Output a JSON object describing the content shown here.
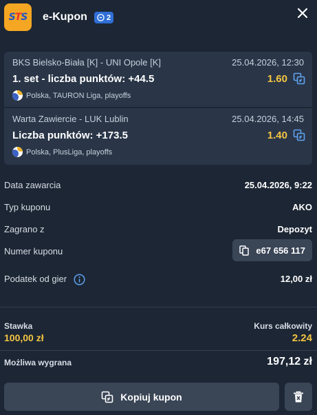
{
  "header": {
    "logo_text_left": "S",
    "logo_text_mid": "T",
    "logo_text_right": "S",
    "title": "e-Kupon",
    "bet_count": "2",
    "close_icon": "close-icon"
  },
  "bets": [
    {
      "match": "BKS Bielsko-Biała [K] - UNI Opole [K]",
      "date": "25.04.2026, 12:30",
      "market": "1. set - liczba punktów: +44.5",
      "odds": "1.60",
      "league": "Polska, TAURON Liga, playoffs",
      "sport_icon": "volleyball-icon"
    },
    {
      "match": "Warta Zawiercie - LUK Lublin",
      "date": "25.04.2026, 14:45",
      "market": "Liczba punktów: +173.5",
      "odds": "1.40",
      "league": "Polska, PlusLiga, playoffs",
      "sport_icon": "volleyball-icon"
    }
  ],
  "details": {
    "date_label": "Data zawarcia",
    "date_value": "25.04.2026, 9:22",
    "type_label": "Typ kuponu",
    "type_value": "AKO",
    "played_label": "Zagrano z",
    "played_value": "Depozyt",
    "number_label": "Numer kuponu",
    "number_value": "e67 656 117",
    "tax_label": "Podatek od gier",
    "tax_value": "12,00 zł"
  },
  "summary": {
    "stake_label": "Stawka",
    "stake_value": "100,00 zł",
    "rate_label": "Kurs całkowity",
    "rate_value": "2.24",
    "win_label": "Możliwa wygrana",
    "win_value": "197,12 zł"
  },
  "actions": {
    "copy_label": "Kopiuj kupon"
  },
  "colors": {
    "background": "#1c2634",
    "card": "#2a3648",
    "accent_yellow": "#f4c542",
    "button": "#3a4556",
    "badge_blue": "#2f6fd6"
  }
}
